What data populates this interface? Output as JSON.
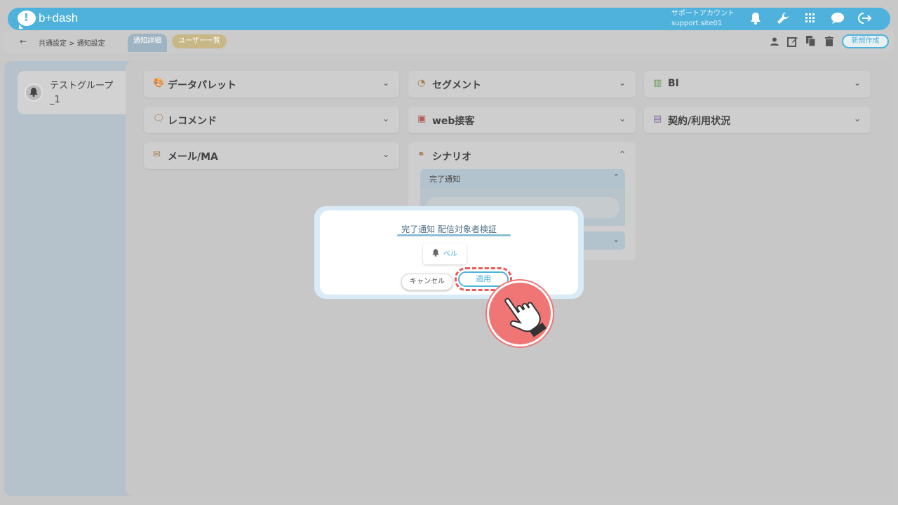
{
  "header": {
    "logo_mark": "!",
    "logo_text": "b+dash",
    "support_name": "サポートアカウント",
    "support_site": "support.site01",
    "icons": [
      "bell-icon",
      "wrench-icon",
      "grid-icon",
      "chat-icon",
      "logout-icon"
    ]
  },
  "subbar": {
    "back": "←",
    "breadcrumb": "共通設定 > 通知設定",
    "tabs": [
      {
        "label": "通知詳細"
      },
      {
        "label": "ユーザー一覧"
      }
    ],
    "new_button": "新規作成",
    "icons": [
      "person-icon",
      "edit-icon",
      "copy-icon",
      "trash-icon"
    ]
  },
  "sidebar": {
    "group_label": "テストグループ_1"
  },
  "cards": {
    "data_palette": "データパレット",
    "segment": "セグメント",
    "bi": "BI",
    "recommend": "レコメンド",
    "web_service": "web接客",
    "contract": "契約/利用状況",
    "mail": "メール/MA",
    "scenario": "シナリオ"
  },
  "scenario": {
    "sub_section": "完了通知"
  },
  "modal": {
    "title": "完了通知 配信対象者検証",
    "chip": "ベル",
    "cancel": "キャンセル",
    "apply": "適用"
  },
  "colors": {
    "accent": "#4fb2dc",
    "highlight": "#e85a5a"
  }
}
